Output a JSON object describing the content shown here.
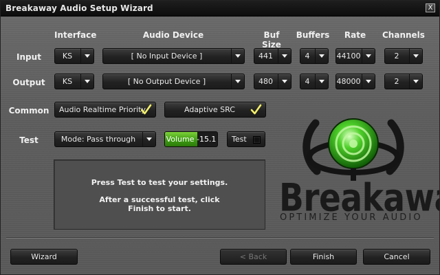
{
  "window": {
    "title": "Breakaway Audio Setup Wizard",
    "close_glyph": "X"
  },
  "headers": {
    "interface": "Interface",
    "audio_device": "Audio Device",
    "buf_size": "Buf Size",
    "buffers": "Buffers",
    "rate": "Rate",
    "channels": "Channels"
  },
  "rows": {
    "input": {
      "label": "Input",
      "interface": "KS",
      "device": "[ No Input Device ]",
      "buf_size": "441",
      "buffers": "4",
      "rate": "44100",
      "channels": "2"
    },
    "output": {
      "label": "Output",
      "interface": "KS",
      "device": "[ No Output Device ]",
      "buf_size": "480",
      "buffers": "4",
      "rate": "48000",
      "channels": "2"
    }
  },
  "common": {
    "label": "Common",
    "realtime_priority": "Audio Realtime Priority",
    "realtime_checked": true,
    "adaptive_src": "Adaptive SRC",
    "adaptive_checked": true
  },
  "test": {
    "label": "Test",
    "mode": "Mode: Pass through",
    "volume_label": "Volume -15.1",
    "volume_fraction": 0.62,
    "test_button": "Test",
    "test_on": false
  },
  "message": {
    "line1": "Press Test to test your settings.",
    "line2": "After a successful test, click",
    "line3": "Finish to start."
  },
  "logo": {
    "text": "Breakaway",
    "tagline": "OPTIMIZE YOUR AUDIO",
    "accent_color": "#3fc01f"
  },
  "footer": {
    "wizard": "Wizard",
    "back": "< Back",
    "finish": "Finish",
    "cancel": "Cancel"
  }
}
